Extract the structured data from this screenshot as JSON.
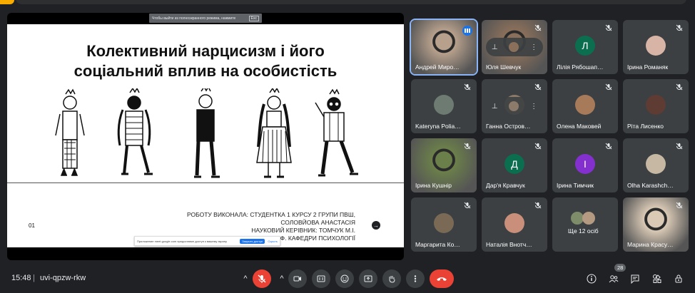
{
  "slide": {
    "fullscreen_hint": "Чтобы выйти из полноэкранного режима, нажмите",
    "fullscreen_key": "Esc",
    "title_line1": "Колективний нарцисизм і його",
    "title_line2": "соціальний вплив на особистість",
    "page_number": "01",
    "credits": [
      "РОБОТУ ВИКОНАЛА: СТУДЕНТКА 1 КУРСУ 2 ГРУПИ ПВШ,",
      "СОЛОВЙОВА АНАСТАСІЯ",
      "НАУКОВИЙ КЕРІВНИК: ТОМЧУК М.І.",
      "ДОКТ.ПСИХОЛ.НАУК, ПРОФ. КАФЕДРИ ПСИХОЛОГІЇ"
    ],
    "cookie_text": "Приложение meet.google.com предоставил доступ к вашему экрану",
    "cookie_agree": "Закрыть доступ",
    "cookie_learn": "Скрыть"
  },
  "participants": [
    {
      "name": "Андрей Миро…",
      "type": "photo",
      "color": "#b7a08c",
      "speaking": true
    },
    {
      "name": "Юля Шевчук",
      "type": "photo-pin",
      "color": "#8a6f5a"
    },
    {
      "name": "Лілія Рябошап…",
      "type": "letter",
      "letter": "Л",
      "color": "#0b6e4f"
    },
    {
      "name": "Ірина Романяк",
      "type": "avatar",
      "color": "#d8b4a6"
    },
    {
      "name": "Kateryna Polia…",
      "type": "avatar",
      "color": "#6d7b73"
    },
    {
      "name": "Ганна Остров…",
      "type": "avatar-pin",
      "color": "#8c7a6b"
    },
    {
      "name": "Олена Маковей",
      "type": "avatar",
      "color": "#a77b5a"
    },
    {
      "name": "Рiта Лисенко",
      "type": "avatar",
      "color": "#5e3b33"
    },
    {
      "name": "Ірина Кушнір",
      "type": "photo",
      "color": "#6b7f4a"
    },
    {
      "name": "Дар'я Кравчук",
      "type": "letter",
      "letter": "Д",
      "color": "#0b6e4f"
    },
    {
      "name": "Ірина Тимчик",
      "type": "letter",
      "letter": "І",
      "color": "#8430ce"
    },
    {
      "name": "Olha Karashch…",
      "type": "avatar",
      "color": "#c7b8a3"
    },
    {
      "name": "Маргарита Ко…",
      "type": "avatar",
      "color": "#7a6a55"
    },
    {
      "name": "Наталія Внотч…",
      "type": "avatar",
      "color": "#c98f7b"
    },
    {
      "name": "Ще 12 осіб",
      "type": "more",
      "color": "#3c4043"
    },
    {
      "name": "Марина Красу…",
      "type": "photo",
      "color": "#d9c9b5"
    }
  ],
  "bottom": {
    "time": "15:48",
    "separator": "|",
    "meeting_code": "uvi-qpzw-rkw",
    "participant_count": "28"
  },
  "icons": {
    "mic_off": "mic-off-icon",
    "camera": "camera-icon",
    "captions": "captions-icon",
    "emoji": "emoji-icon",
    "present": "present-icon",
    "raise_hand": "raise-hand-icon",
    "more": "more-options-icon",
    "end_call": "end-call-icon",
    "info": "info-icon",
    "people": "people-icon",
    "chat": "chat-icon",
    "activities": "activities-icon",
    "lock": "host-controls-icon"
  },
  "colors": {
    "background": "#202124",
    "tile": "#3c4043",
    "accent": "#8ab4f8",
    "end_call": "#ea4335",
    "mic_off": "#ea4335"
  }
}
